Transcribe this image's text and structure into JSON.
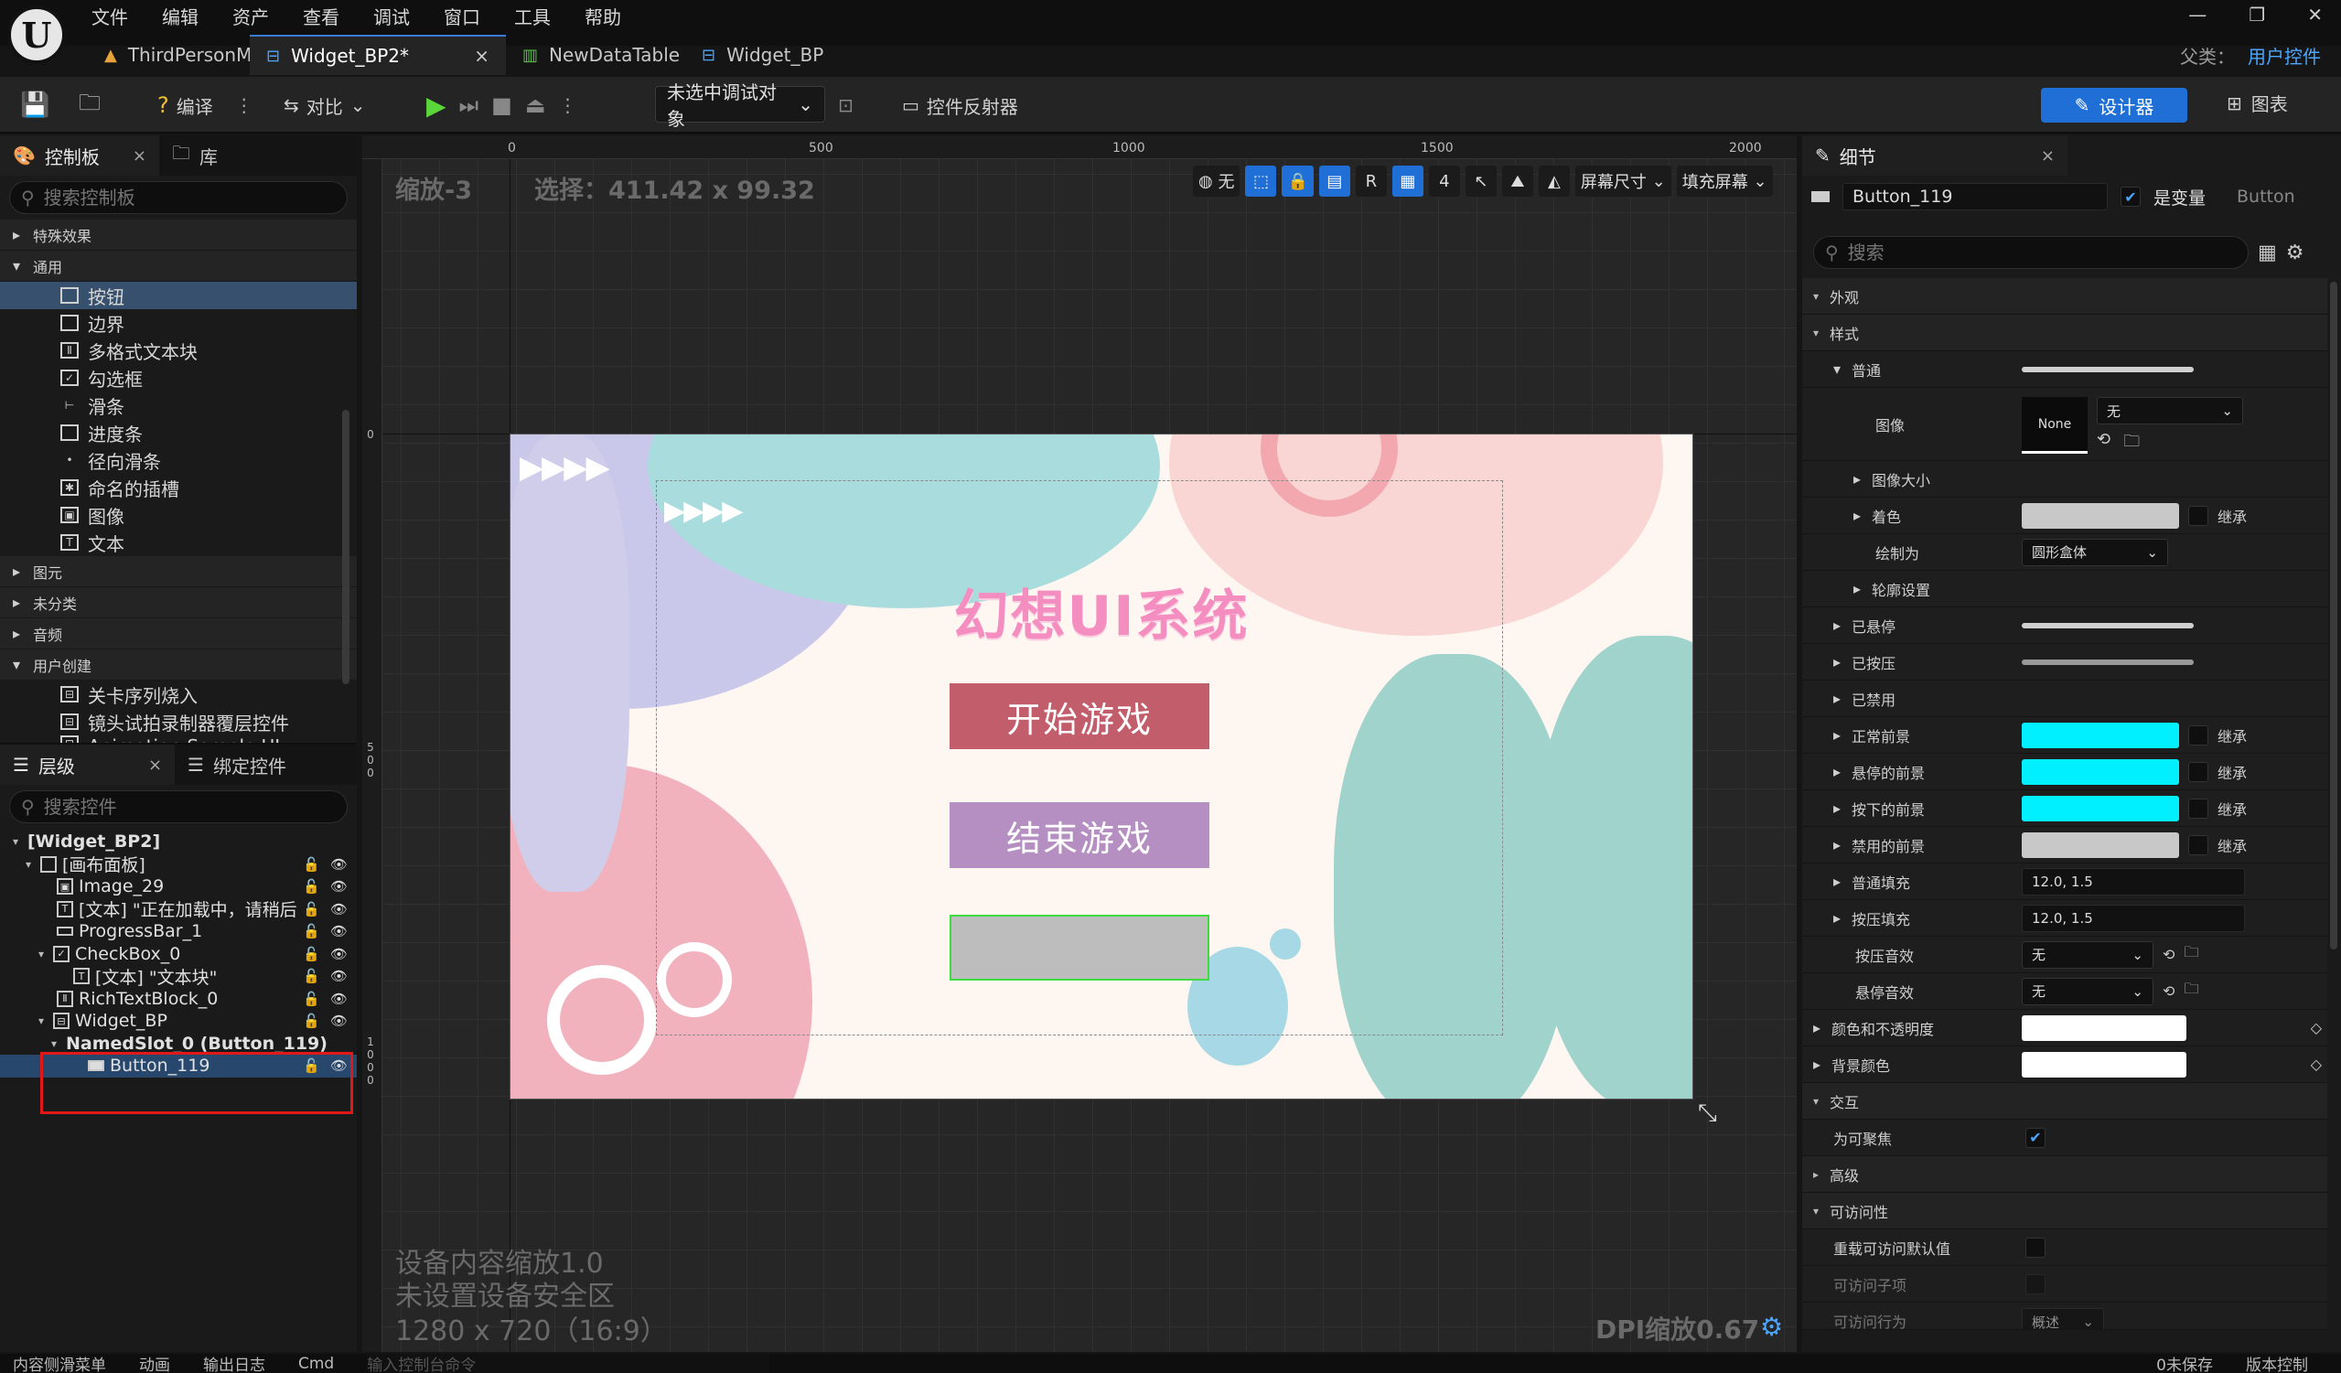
{
  "menu": [
    "文件",
    "编辑",
    "资产",
    "查看",
    "调试",
    "窗口",
    "工具",
    "帮助"
  ],
  "window_controls": {
    "minimize": "—",
    "restore": "❐",
    "close": "✕"
  },
  "tabs": [
    {
      "label": "ThirdPersonMap",
      "icon": "map-icon"
    },
    {
      "label": "Widget_BP2*",
      "icon": "widget-icon",
      "close": "×"
    },
    {
      "label": "NewDataTable",
      "icon": "datatable-icon"
    },
    {
      "label": "Widget_BP",
      "icon": "widget-icon"
    }
  ],
  "parent_class": {
    "label": "父类：",
    "value": "用户控件"
  },
  "toolbar": {
    "compile": "编译",
    "diff": "对比",
    "debug_target": "未选中调试对象",
    "widget_reflector": "控件反射器",
    "designer": "设计器",
    "graph": "图表"
  },
  "palette": {
    "tab": "控制板",
    "tab_close": "×",
    "lib_tab": "库",
    "search_placeholder": "搜索控制板",
    "categories": {
      "special": "特殊效果",
      "common": "通用",
      "primitive": "图元",
      "uncategorized": "未分类",
      "audio": "音频",
      "user_created": "用户创建"
    },
    "common_items": [
      "按钮",
      "边界",
      "多格式文本块",
      "勾选框",
      "滑条",
      "进度条",
      "径向滑条",
      "命名的插槽",
      "图像",
      "文本"
    ],
    "user_items": [
      "关卡序列烧入",
      "镜头试拍录制器覆层控件",
      "Animation Sample UI"
    ]
  },
  "hierarchy": {
    "tab": "层级",
    "tab_close": "×",
    "bind_tab": "绑定控件",
    "search_placeholder": "搜索控件",
    "rows": [
      {
        "label": "[Widget_BP2]",
        "indent": 0
      },
      {
        "label": "[画布面板]",
        "indent": 1
      },
      {
        "label": "Image_29",
        "indent": 2
      },
      {
        "label": "[文本] \"正在加载中，请稍后\"",
        "indent": 2
      },
      {
        "label": "ProgressBar_1",
        "indent": 2
      },
      {
        "label": "CheckBox_0",
        "indent": 2
      },
      {
        "label": "[文本] \"文本块\"",
        "indent": 3
      },
      {
        "label": "RichTextBlock_0",
        "indent": 2
      },
      {
        "label": "Widget_BP",
        "indent": 2
      },
      {
        "label": "NamedSlot_0 (Button_119)",
        "indent": 3
      },
      {
        "label": "Button_119",
        "indent": 4
      }
    ]
  },
  "viewport": {
    "zoom": "缩放-3",
    "selection": "选择：411.42 x 99.32",
    "ruler_h": [
      "0",
      "500",
      "1000",
      "1500",
      "2000"
    ],
    "ruler_v": [
      "0",
      "500",
      "1000"
    ],
    "tools": {
      "none": "无",
      "r": "R",
      "grid_num": "4",
      "screen_size": "屏幕尺寸",
      "fill_screen": "填充屏幕"
    },
    "device_scale": "设备内容缩放1.0",
    "safe_zone": "未设置设备安全区",
    "resolution": "1280 x 720（16:9）",
    "dpi": "DPI缩放0.67"
  },
  "game_ui": {
    "title": "幻想UI系统",
    "start_button": "开始游戏",
    "end_button": "结束游戏",
    "arrows": "▶▶▶▶"
  },
  "details": {
    "tab": "细节",
    "tab_close": "×",
    "widget_name": "Button_119",
    "is_variable": "是变量",
    "type": "Button",
    "search_placeholder": "搜索",
    "sections": {
      "appearance": "外观",
      "style": "样式",
      "normal": "普通",
      "image": "图像",
      "image_size": "图像大小",
      "tint": "着色",
      "draw_as": "绘制为",
      "outline": "轮廓设置",
      "hovered": "已悬停",
      "pressed": "已按压",
      "disabled": "已禁用",
      "normal_fg": "正常前景",
      "hover_fg": "悬停的前景",
      "press_fg": "按下的前景",
      "disabled_fg": "禁用的前景",
      "normal_pad": "普通填充",
      "press_pad": "按压填充",
      "press_sound": "按压音效",
      "hover_sound": "悬停音效",
      "color_opacity": "颜色和不透明度",
      "bg_color": "背景颜色",
      "interaction": "交互",
      "focusable": "为可聚焦",
      "advanced": "高级",
      "accessibility": "可访问性",
      "override_access": "重载可访问默认值",
      "access_children": "可访问子项",
      "access_behavior": "可访问行为"
    },
    "values": {
      "image_none": "None",
      "image_dd": "无",
      "draw_as": "圆形盒体",
      "inherit": "继承",
      "normal_pad": "12.0, 1.5",
      "press_pad": "12.0, 1.5",
      "sound_none": "无",
      "summary": "概述"
    },
    "colors": {
      "tint": "#c8c8c8",
      "cyan": "#00f0ff",
      "gray": "#c8c8c8",
      "white": "#ffffff"
    }
  },
  "statusbar": [
    "内容侧滑菜单",
    "动画",
    "输出日志",
    "Cmd",
    "输入控制台命令",
    "0未保存",
    "版本控制"
  ]
}
